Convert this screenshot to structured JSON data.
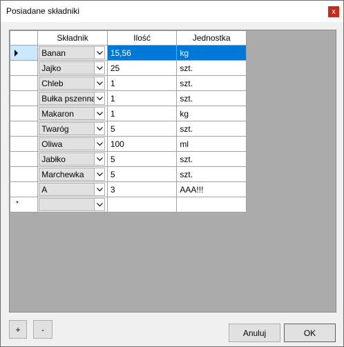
{
  "window": {
    "title": "Posiadane składniki",
    "close_label": "x"
  },
  "grid": {
    "headers": [
      "Składnik",
      "Ilość",
      "Jednostka"
    ],
    "rows": [
      {
        "item": "Banan",
        "qty": "15,56",
        "unit": "kg"
      },
      {
        "item": "Jajko",
        "qty": "25",
        "unit": "szt."
      },
      {
        "item": "Chleb",
        "qty": "1",
        "unit": "szt."
      },
      {
        "item": "Bułka pszenna",
        "qty": "1",
        "unit": "szt."
      },
      {
        "item": "Makaron",
        "qty": "1",
        "unit": "kg"
      },
      {
        "item": "Twaróg",
        "qty": "5",
        "unit": "szt."
      },
      {
        "item": "Oliwa",
        "qty": "100",
        "unit": "ml"
      },
      {
        "item": "Jabłko",
        "qty": "5",
        "unit": "szt."
      },
      {
        "item": "Marchewka",
        "qty": "5",
        "unit": "szt."
      },
      {
        "item": "A",
        "qty": "3",
        "unit": "AAA!!!"
      }
    ],
    "new_row_marker": "*"
  },
  "buttons": {
    "add": "+",
    "remove": "-",
    "cancel": "Anuluj",
    "ok": "OK"
  }
}
